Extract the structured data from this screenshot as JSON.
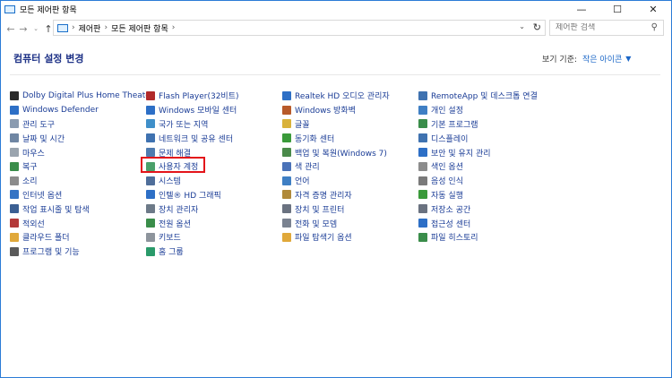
{
  "window": {
    "title": "모든 제어판 항목",
    "min": "—",
    "max": "☐",
    "close": "✕"
  },
  "address": {
    "crumbs": [
      "제어판",
      "모든 제어판 항목"
    ],
    "search_placeholder": "제어판 검색"
  },
  "header": {
    "title": "컴퓨터 설정 변경",
    "view_by_label": "보기 기준:",
    "view_by_value": "작은 아이콘"
  },
  "columns": [
    [
      {
        "label": "Dolby Digital Plus Home Theater",
        "icon": "dolby-icon",
        "color": "#2a2a2a"
      },
      {
        "label": "Windows Defender",
        "icon": "defender-shield-icon",
        "color": "#2d6fc6"
      },
      {
        "label": "관리 도구",
        "icon": "admin-tools-icon",
        "color": "#8a9bb0"
      },
      {
        "label": "날짜 및 시간",
        "icon": "clock-icon",
        "color": "#6f86a3"
      },
      {
        "label": "마우스",
        "icon": "mouse-icon",
        "color": "#9aa4ae"
      },
      {
        "label": "복구",
        "icon": "recovery-icon",
        "color": "#3a8d4a"
      },
      {
        "label": "소리",
        "icon": "speaker-icon",
        "color": "#8c8c8c"
      },
      {
        "label": "인터넷 옵션",
        "icon": "internet-options-icon",
        "color": "#3574c4"
      },
      {
        "label": "작업 표시줄 및 탐색",
        "icon": "taskbar-icon",
        "color": "#3b5f93"
      },
      {
        "label": "적외선",
        "icon": "infrared-icon",
        "color": "#b33a3a"
      },
      {
        "label": "클라우드 폴더",
        "icon": "cloud-folder-icon",
        "color": "#e0a83a"
      },
      {
        "label": "프로그램 및 기능",
        "icon": "programs-icon",
        "color": "#5a5a5a"
      }
    ],
    [
      {
        "label": "Flash Player(32비트)",
        "icon": "flash-icon",
        "color": "#b12a2a"
      },
      {
        "label": "Windows 모바일 센터",
        "icon": "mobility-center-icon",
        "color": "#2d6fc6"
      },
      {
        "label": "국가 또는 지역",
        "icon": "globe-clock-icon",
        "color": "#3f8fc9"
      },
      {
        "label": "네트워크 및 공유 센터",
        "icon": "network-icon",
        "color": "#3f72b0"
      },
      {
        "label": "문제 해결",
        "icon": "troubleshoot-icon",
        "color": "#4e7bb0"
      },
      {
        "label": "사용자 계정",
        "icon": "user-accounts-icon",
        "color": "#4aa06a"
      },
      {
        "label": "시스템",
        "icon": "system-icon",
        "color": "#4f6e9a"
      },
      {
        "label": "인텔® HD 그래픽",
        "icon": "intel-graphics-icon",
        "color": "#2d6fc6"
      },
      {
        "label": "장치 관리자",
        "icon": "device-manager-icon",
        "color": "#6d7a88"
      },
      {
        "label": "전원 옵션",
        "icon": "power-icon",
        "color": "#3a8d4a"
      },
      {
        "label": "키보드",
        "icon": "keyboard-icon",
        "color": "#8d949c"
      },
      {
        "label": "홈 그룹",
        "icon": "homegroup-icon",
        "color": "#2a9a6a"
      }
    ],
    [
      {
        "label": "Realtek HD 오디오 관리자",
        "icon": "realtek-audio-icon",
        "color": "#2d6fc6"
      },
      {
        "label": "Windows 방화벽",
        "icon": "firewall-icon",
        "color": "#b85a2a"
      },
      {
        "label": "글꼴",
        "icon": "fonts-icon",
        "color": "#d9b23a"
      },
      {
        "label": "동기화 센터",
        "icon": "sync-center-icon",
        "color": "#3a9a3a"
      },
      {
        "label": "백업 및 복원(Windows 7)",
        "icon": "backup-icon",
        "color": "#4a8a4a"
      },
      {
        "label": "색 관리",
        "icon": "color-management-icon",
        "color": "#4a72b8"
      },
      {
        "label": "언어",
        "icon": "language-icon",
        "color": "#3f7fc4"
      },
      {
        "label": "자격 증명 관리자",
        "icon": "credential-manager-icon",
        "color": "#b08a3a"
      },
      {
        "label": "장치 및 프린터",
        "icon": "printer-icon",
        "color": "#6a7280"
      },
      {
        "label": "전화 및 모뎀",
        "icon": "phone-modem-icon",
        "color": "#7a8290"
      },
      {
        "label": "파일 탐색기 옵션",
        "icon": "folder-options-icon",
        "color": "#e0a83a"
      }
    ],
    [
      {
        "label": "RemoteApp 및 데스크톱 연결",
        "icon": "remoteapp-icon",
        "color": "#3f72b0"
      },
      {
        "label": "개인 설정",
        "icon": "personalization-icon",
        "color": "#3f7fc4"
      },
      {
        "label": "기본 프로그램",
        "icon": "default-programs-icon",
        "color": "#3a8d4a"
      },
      {
        "label": "디스플레이",
        "icon": "display-icon",
        "color": "#3f72b0"
      },
      {
        "label": "보안 및 유지 관리",
        "icon": "security-maintenance-icon",
        "color": "#2d6fc6"
      },
      {
        "label": "색인 옵션",
        "icon": "indexing-icon",
        "color": "#8c8c8c"
      },
      {
        "label": "음성 인식",
        "icon": "microphone-icon",
        "color": "#7a7a7a"
      },
      {
        "label": "자동 실행",
        "icon": "autoplay-icon",
        "color": "#3a9a3a"
      },
      {
        "label": "저장소 공간",
        "icon": "storage-spaces-icon",
        "color": "#6a7280"
      },
      {
        "label": "접근성 센터",
        "icon": "accessibility-icon",
        "color": "#2d6fc6"
      },
      {
        "label": "파일 히스토리",
        "icon": "file-history-icon",
        "color": "#3a8d4a"
      }
    ]
  ]
}
